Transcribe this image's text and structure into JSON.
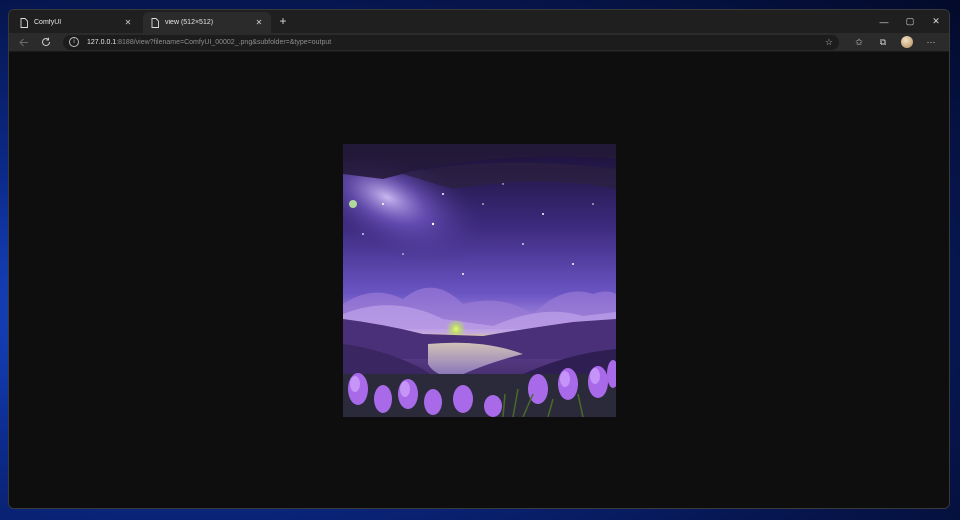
{
  "browser": {
    "tabs": [
      {
        "label": "ComfyUI",
        "active": false
      },
      {
        "label": "view (512×512)",
        "active": true
      }
    ],
    "address": {
      "host": "127.0.0.1",
      "path": ":8188/view?filename=ComfyUI_00002_.png&subfolder=&type=output"
    },
    "window_controls": {
      "minimize": "—",
      "maximize": "▢",
      "close": "✕"
    }
  },
  "image": {
    "alt": "ComfyUI_00002_.png",
    "width": 512,
    "height": 512
  },
  "colors": {
    "page_bg": "#0e0e0e",
    "tabbar_bg": "#1f1f1f",
    "toolbar_bg": "#2b2b2b"
  }
}
